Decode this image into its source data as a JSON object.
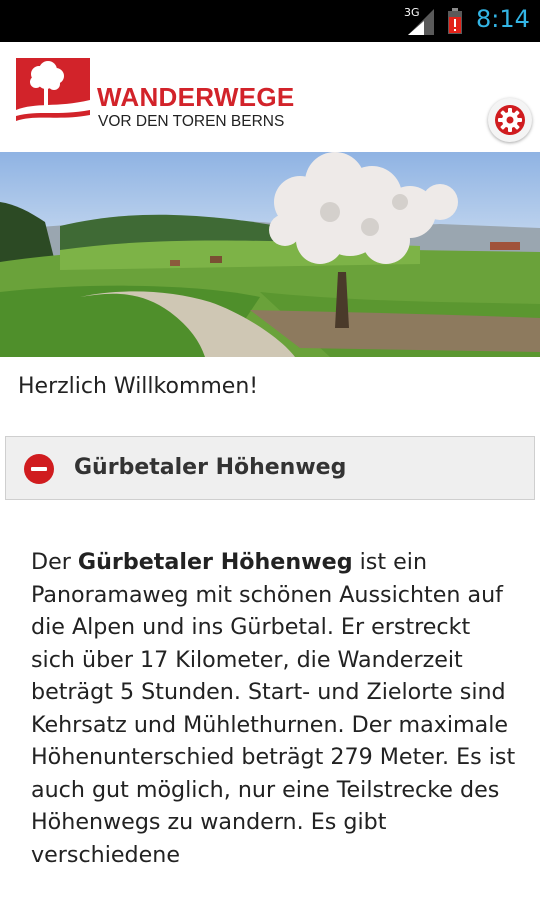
{
  "status_bar": {
    "network": "3G",
    "time": "8:14"
  },
  "header": {
    "logo_title": "WANDERWEGE",
    "logo_subtitle": "VOR DEN TOREN BERNS",
    "settings_icon": "gear-icon"
  },
  "welcome": "Herzlich Willkommen!",
  "route": {
    "title": "Gürbetaler Höhenweg",
    "toggle_icon": "minus-circle-icon",
    "description_intro": "Der ",
    "description_bold": "Gürbetaler Höhenweg",
    "description_rest": " ist ein Panoramaweg mit schönen Aussichten auf die Alpen und ins Gürbetal. Er erstreckt sich über 17 Kilometer, die Wanderzeit beträgt 5 Stunden. Start- und Zielorte sind Kehrsatz und Mühlethurnen. Der maximale Höhenunterschied beträgt 279 Meter. Es ist auch gut möglich, nur eine Teilstrecke des Höhenwegs zu wandern. Es gibt verschiedene"
  },
  "colors": {
    "brand_red": "#d2232a",
    "status_time": "#33b5e5"
  }
}
